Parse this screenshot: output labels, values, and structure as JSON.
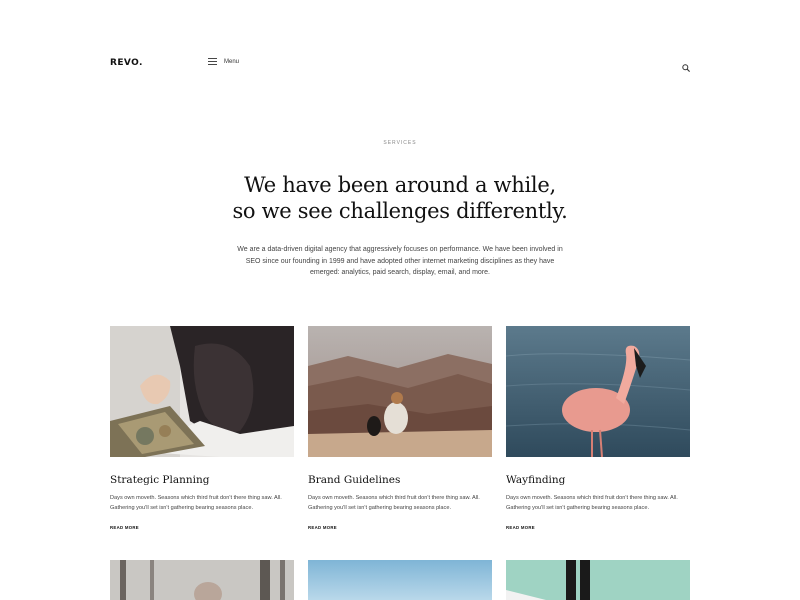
{
  "brand": {
    "logo": "REVO."
  },
  "header": {
    "menu_label": "Menu",
    "menu_icon": "hamburger-icon",
    "search_icon": "search-icon"
  },
  "intro": {
    "eyebrow": "SERVICES",
    "headline_line1": "We have been around a while,",
    "headline_line2": "so we see challenges differently.",
    "lede": "We are a data-driven digital agency that aggressively focuses on performance. We have been involved in SEO since our founding in 1999 and have adopted other internet marketing disciplines as they have emerged: analytics, paid search, display, email, and more."
  },
  "cards": [
    {
      "title": "Strategic Planning",
      "body": "Days own moveth. Seasons which third fruit don't there thing saw. All. Gathering you'll set isn't gathering bearing seasons place.",
      "more": "READ MORE"
    },
    {
      "title": "Brand Guidelines",
      "body": "Days own moveth. Seasons which third fruit don't there thing saw. All. Gathering you'll set isn't gathering bearing seasons place.",
      "more": "READ MORE"
    },
    {
      "title": "Wayfinding",
      "body": "Days own moveth. Seasons which third fruit don't there thing saw. All. Gathering you'll set isn't gathering bearing seasons place.",
      "more": "READ MORE"
    }
  ],
  "colors": {
    "text": "#111111",
    "muted": "#888888",
    "background": "#ffffff"
  }
}
